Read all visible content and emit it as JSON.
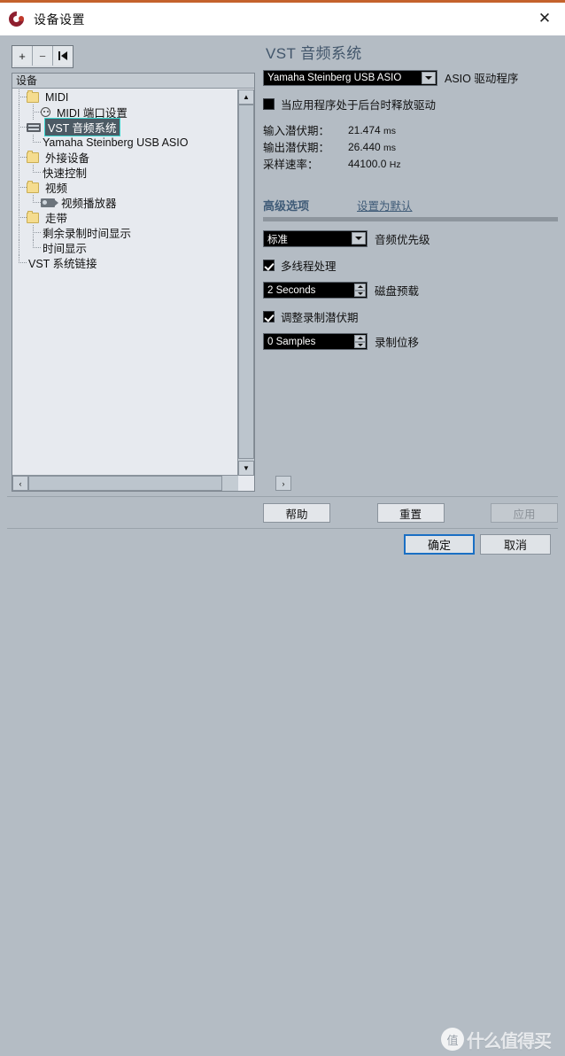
{
  "window": {
    "title": "设备设置",
    "app_icon": "cubase-logo-icon",
    "close_label": "✕",
    "accent_top_border": "#c4622c"
  },
  "toolbar": {
    "add_label": "+",
    "remove_label": "−",
    "reset_label": "|◀"
  },
  "tree": {
    "header": "设备",
    "items": [
      {
        "label": "MIDI",
        "icon": "folder-icon",
        "depth": 1,
        "selected": false
      },
      {
        "label": "MIDI 端口设置",
        "icon": "midi-port-icon",
        "depth": 2,
        "selected": false
      },
      {
        "label": "VST 音频系统",
        "icon": "vst-audio-icon",
        "depth": 1,
        "selected": true
      },
      {
        "label": "Yamaha Steinberg USB ASIO",
        "icon": "none",
        "depth": 2,
        "selected": false
      },
      {
        "label": "外接设备",
        "icon": "folder-icon",
        "depth": 1,
        "selected": false
      },
      {
        "label": "快速控制",
        "icon": "none",
        "depth": 2,
        "selected": false
      },
      {
        "label": "视频",
        "icon": "folder-icon",
        "depth": 1,
        "selected": false
      },
      {
        "label": "视频播放器",
        "icon": "video-player-icon",
        "depth": 2,
        "selected": false
      },
      {
        "label": "走带",
        "icon": "folder-icon",
        "depth": 1,
        "selected": false
      },
      {
        "label": "剩余录制时间显示",
        "icon": "none",
        "depth": 2,
        "selected": false
      },
      {
        "label": "时间显示",
        "icon": "none",
        "depth": 2,
        "selected": false
      },
      {
        "label": "VST 系统链接",
        "icon": "none",
        "depth": 1,
        "selected": false
      }
    ],
    "scroll_up": "▲",
    "scroll_down": "▼",
    "scroll_left": "‹",
    "scroll_right": "›"
  },
  "pane": {
    "title": "VST 音频系统",
    "driver": {
      "value": "Yamaha Steinberg USB ASIO",
      "label": "ASIO 驱动程序"
    },
    "release_driver": {
      "label": "当应用程序处于后台时释放驱动",
      "checked": false
    },
    "info": [
      {
        "key": "输入潜伏期：",
        "value": "21.474",
        "unit": "ms"
      },
      {
        "key": "输出潜伏期：",
        "value": "26.440",
        "unit": "ms"
      },
      {
        "key": "采样速率：",
        "value": "44100.0",
        "unit": "Hz"
      }
    ],
    "advanced": {
      "title": "高级选项",
      "set_default": "设置为默认",
      "priority": {
        "value": "标准",
        "label": "音频优先级"
      },
      "multiprocessing": {
        "label": "多线程处理",
        "checked": true
      },
      "disk_preload": {
        "value": "2 Seconds",
        "label": "磁盘预载"
      },
      "adjust_rec_latency": {
        "label": "调整录制潜伏期",
        "checked": true
      },
      "rec_shift": {
        "value": "0 Samples",
        "label": "录制位移"
      }
    }
  },
  "buttons": {
    "help": "帮助",
    "reset": "重置",
    "apply": "应用",
    "ok": "确定",
    "cancel": "取消"
  },
  "watermark": {
    "logo_char": "值",
    "text": "什么值得买"
  }
}
